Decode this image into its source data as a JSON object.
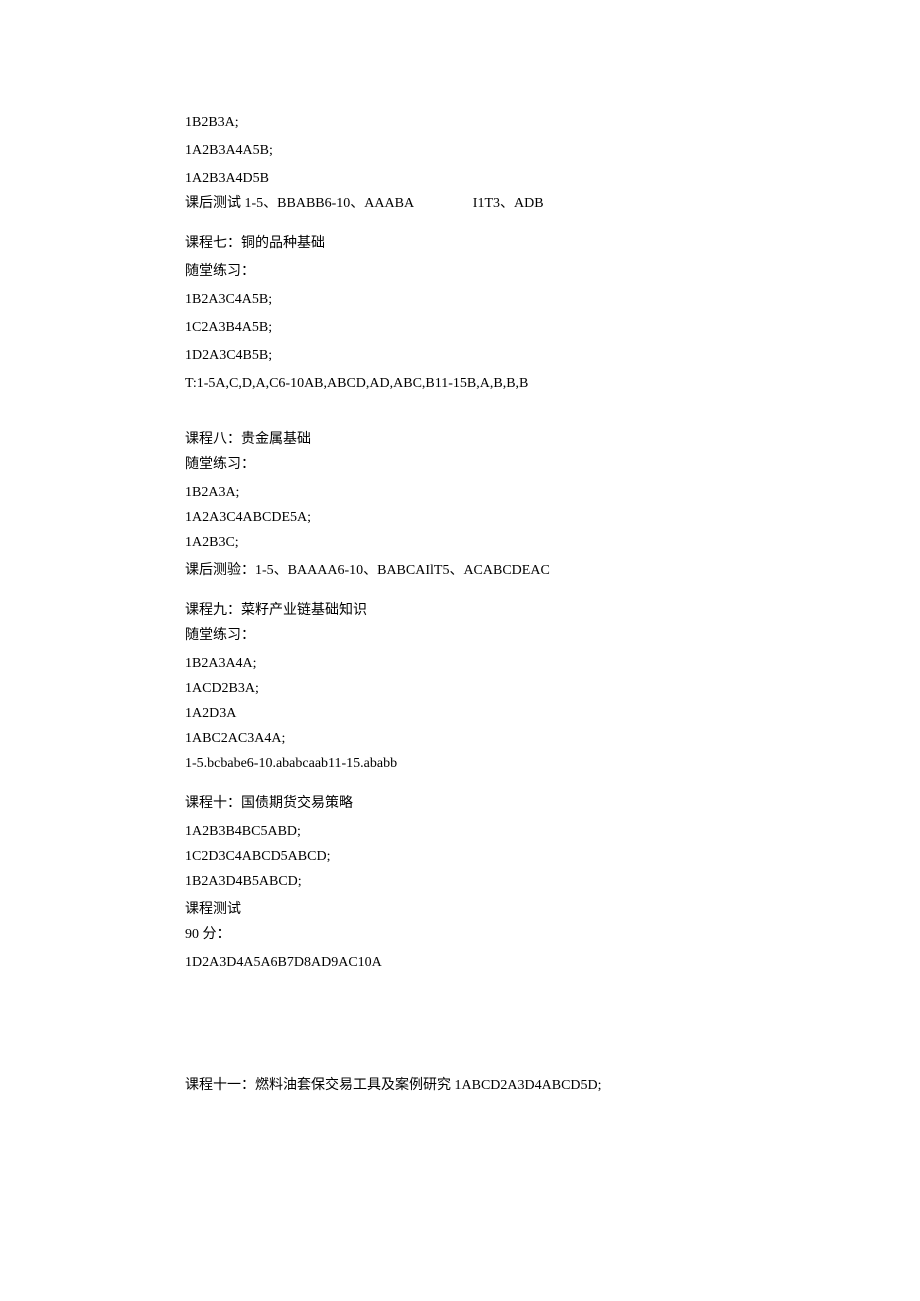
{
  "block1": {
    "l1": "1B2B3A;",
    "l2": "1A2B3A4A5B;",
    "l3": "1A2B3A4D5B",
    "l4": "课后测试 1-5、BBABB6-10、AAABA                 I1T3、ADB"
  },
  "course7": {
    "title": "课程七：铜的品种基础",
    "subtitle": "随堂练习：",
    "l1": "1B2A3C4A5B;",
    "l2": "1C2A3B4A5B;",
    "l3": "1D2A3C4B5B;",
    "l4": "T:1-5A,C,D,A,C6-10AB,ABCD,AD,ABC,B11-15B,A,B,B,B"
  },
  "course8": {
    "title": "课程八：贵金属基础",
    "subtitle": "随堂练习：",
    "l1": "1B2A3A;",
    "l2": "1A2A3C4ABCDE5A;",
    "l3": "1A2B3C;",
    "l4": "课后测验：1-5、BAAAA6-10、BABCAIlT5、ACABCDEAC"
  },
  "course9": {
    "title": "课程九：菜籽产业链基础知识",
    "subtitle": "随堂练习：",
    "l1": "1B2A3A4A;",
    "l2": "1ACD2B3A;",
    "l3": "1A2D3A",
    "l4": "1ABC2AC3A4A;",
    "l5": "1-5.bcbabe6-10.ababcaab11-15.ababb"
  },
  "course10": {
    "title": "课程十：国债期货交易策略",
    "l1": "1A2B3B4BC5ABD;",
    "l2": "1C2D3C4ABCD5ABCD;",
    "l3": "1B2A3D4B5ABCD;",
    "l4": "课程测试",
    "l5": "90 分：",
    "l6": "1D2A3D4A5A6B7D8AD9AC10A"
  },
  "course11": {
    "title": "课程十一：燃料油套保交易工具及案例研究 1ABCD2A3D4ABCD5D;"
  }
}
